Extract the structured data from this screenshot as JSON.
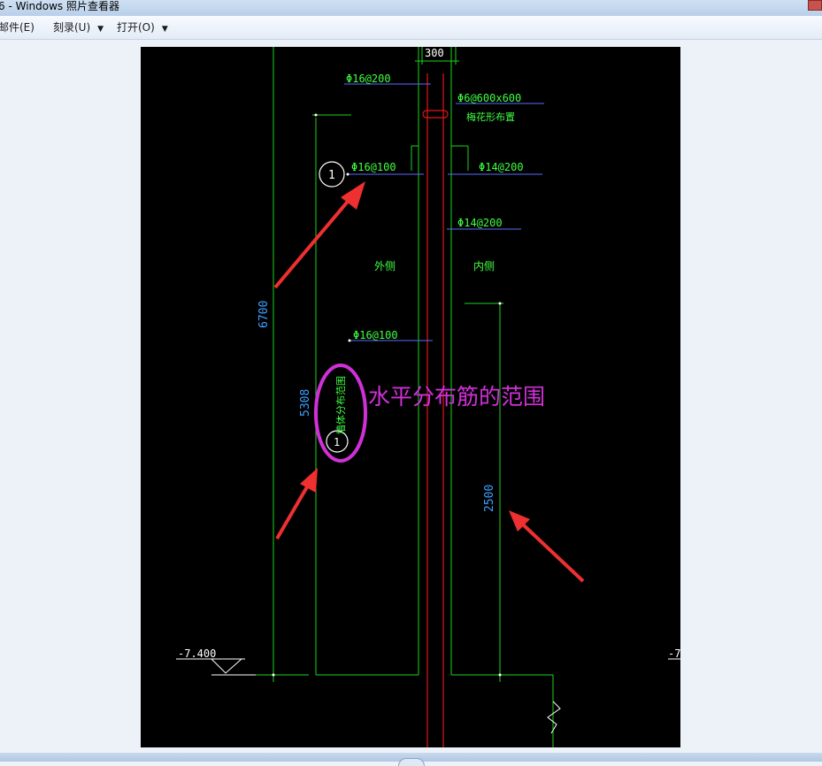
{
  "window": {
    "title": "6 - Windows 照片查看器"
  },
  "menu": {
    "email": "邮件(E)",
    "burn": "刻录(U)",
    "open": "打开(O)"
  },
  "drawing": {
    "dim_300": "300",
    "dim_6700": "6700",
    "dim_5308": "5308",
    "dim_2500": "2500",
    "rebar_top": "Φ16@200",
    "tie": "Φ6@600x600",
    "tie_note": "梅花形布置",
    "rebar_outer": "Φ16@100",
    "rebar_inner": "Φ14@200",
    "rebar_inner2": "Φ14@200",
    "outer_side": "外侧",
    "inner_side": "内侧",
    "rebar_mid": "Φ16@100",
    "vertical_note": "墙体分布范围",
    "elev_left": "-7.400",
    "elev_right": "-7",
    "callout_1": "1",
    "callout_2": "1",
    "annotation": "水平分布筋的范围"
  },
  "colors": {
    "cad_green": "#1bd51b",
    "cad_text": "#40ff40",
    "dim_cyan": "#3da0ff",
    "rebar_red": "#e01818",
    "leader_blue": "#5b6cff",
    "annotation_magenta": "#d030d8",
    "arrow_red": "#ee3030"
  }
}
